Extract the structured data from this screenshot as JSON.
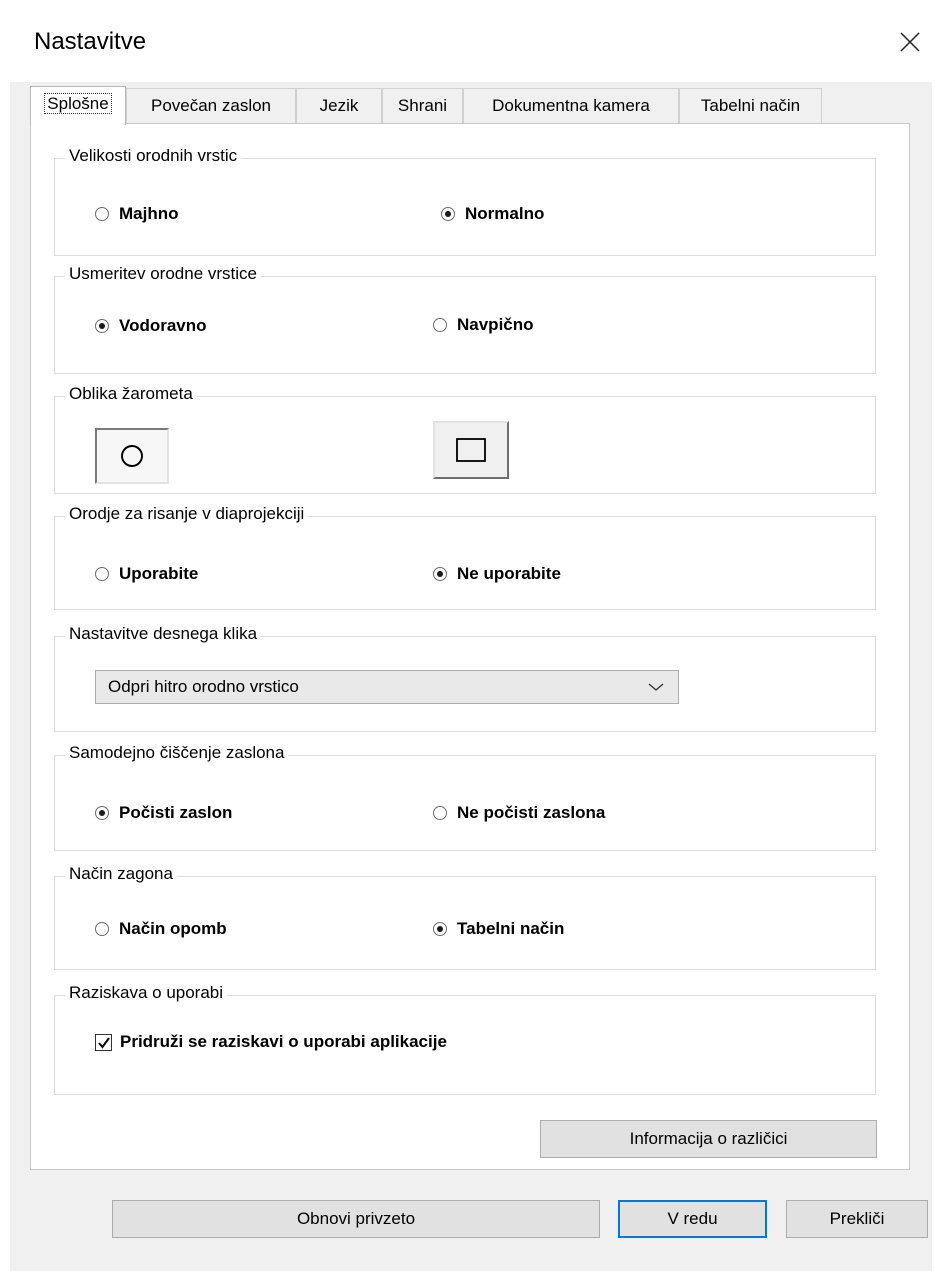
{
  "window": {
    "title": "Nastavitve",
    "close_icon": "close-icon"
  },
  "tabs": [
    {
      "label": "Splošne",
      "active": true
    },
    {
      "label": "Povečan zaslon",
      "active": false
    },
    {
      "label": "Jezik",
      "active": false
    },
    {
      "label": "Shrani",
      "active": false
    },
    {
      "label": "Dokumentna kamera",
      "active": false
    },
    {
      "label": "Tabelni način",
      "active": false
    }
  ],
  "toolbar_size": {
    "label": "Velikosti orodnih vrstic",
    "options": [
      {
        "label": "Majhno",
        "checked": false
      },
      {
        "label": "Normalno",
        "checked": true
      }
    ]
  },
  "toolbar_orientation": {
    "label": "Usmeritev orodne vrstice",
    "options": [
      {
        "label": "Vodoravno",
        "checked": true
      },
      {
        "label": "Navpično",
        "checked": false
      }
    ]
  },
  "spotlight_shape": {
    "label": "Oblika žarometa",
    "options": [
      {
        "icon": "circle-icon",
        "selected": true
      },
      {
        "icon": "square-icon",
        "selected": false
      }
    ]
  },
  "drawing_tool": {
    "label": "Orodje za risanje v diaprojekciji",
    "options": [
      {
        "label": "Uporabite",
        "checked": false
      },
      {
        "label": "Ne uporabite",
        "checked": true
      }
    ]
  },
  "right_click": {
    "label": "Nastavitve desnega klika",
    "selected": "Odpri hitro orodno vrstico",
    "arrow_icon": "chevron-down-icon"
  },
  "auto_clear": {
    "label": "Samodejno čiščenje zaslona",
    "options": [
      {
        "label": "Počisti zaslon",
        "checked": true
      },
      {
        "label": "Ne počisti zaslona",
        "checked": false
      }
    ]
  },
  "startup_mode": {
    "label": "Način zagona",
    "options": [
      {
        "label": "Način opomb",
        "checked": false
      },
      {
        "label": "Tabelni način",
        "checked": true
      }
    ]
  },
  "usage_survey": {
    "label": "Raziskava o uporabi",
    "checkbox_label": "Pridruži se raziskavi o uporabi aplikacije",
    "checked": true
  },
  "buttons": {
    "version_info": "Informacija o različici",
    "restore_defaults": "Obnovi privzeto",
    "ok": "V redu",
    "cancel": "Prekliči"
  },
  "colors": {
    "accent": "#0078d7",
    "dialog_bg": "#f0f0f0",
    "panel_bg": "#ffffff"
  }
}
